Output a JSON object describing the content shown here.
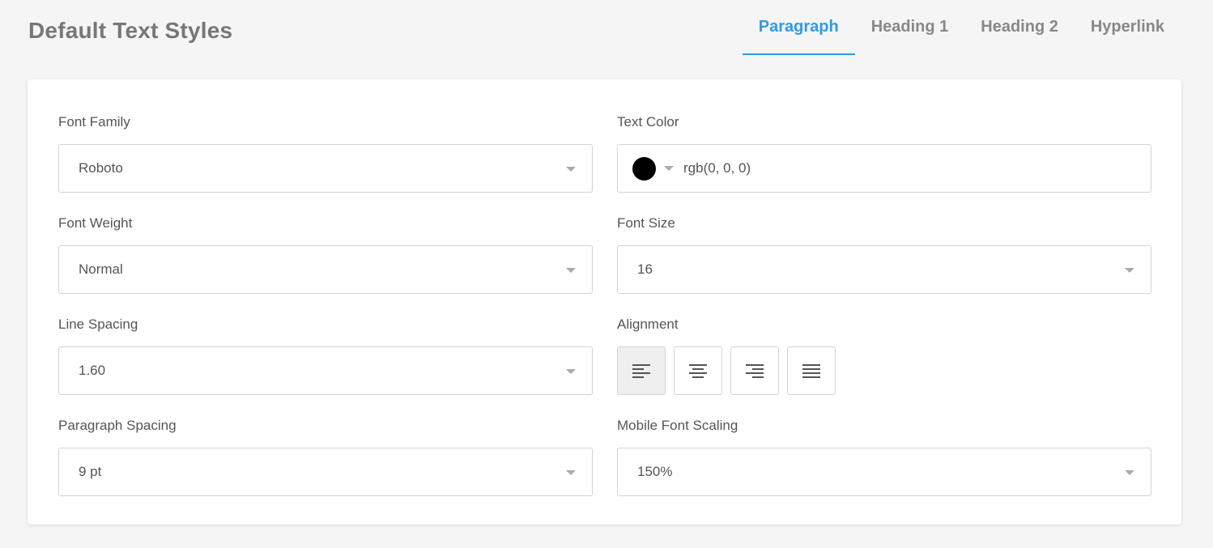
{
  "page": {
    "title": "Default Text Styles"
  },
  "tabs": [
    {
      "label": "Paragraph",
      "active": true
    },
    {
      "label": "Heading 1",
      "active": false
    },
    {
      "label": "Heading 2",
      "active": false
    },
    {
      "label": "Hyperlink",
      "active": false
    }
  ],
  "form": {
    "font_family": {
      "label": "Font Family",
      "value": "Roboto"
    },
    "text_color": {
      "label": "Text Color",
      "value": "rgb(0, 0, 0)",
      "swatch": "#000000"
    },
    "font_weight": {
      "label": "Font Weight",
      "value": "Normal"
    },
    "font_size": {
      "label": "Font Size",
      "value": "16"
    },
    "line_spacing": {
      "label": "Line Spacing",
      "value": "1.60"
    },
    "alignment": {
      "label": "Alignment",
      "options": [
        "align-left-icon",
        "align-center-icon",
        "align-right-icon",
        "align-justify-icon"
      ],
      "selected": "align-left-icon"
    },
    "paragraph_spacing": {
      "label": "Paragraph Spacing",
      "value": "9 pt"
    },
    "mobile_font_scaling": {
      "label": "Mobile Font Scaling",
      "value": "150%"
    }
  },
  "colors": {
    "accent": "#2f9be6",
    "border": "#d4d4d4",
    "background": "#f5f5f5"
  }
}
